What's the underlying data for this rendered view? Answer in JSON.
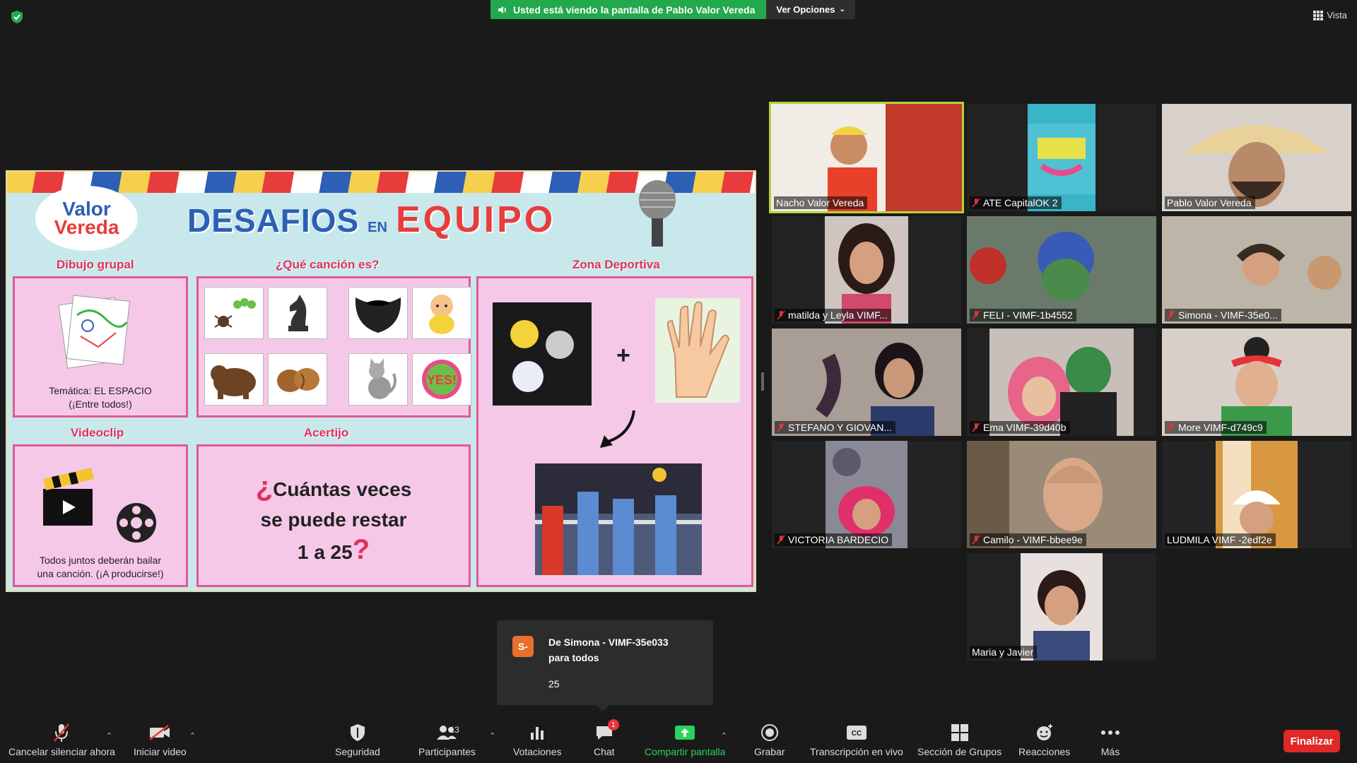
{
  "top_bar": {
    "share_message": "Usted está viendo la pantalla de Pablo Valor Vereda",
    "view_options": "Ver Opciones",
    "view_label": "Vista"
  },
  "slide": {
    "logo_top": "Valor",
    "logo_bottom": "Vereda",
    "title_part1": "DESAFIOS",
    "title_part2": "EN",
    "title_part3": "EQUIPO",
    "sections": {
      "dibujo": {
        "label": "Dibujo grupal",
        "caption_line1": "Temática: EL ESPACIO",
        "caption_line2": "(¡Entre todos!)"
      },
      "cancion": {
        "label": "¿Qué canción es?"
      },
      "deportiva": {
        "label": "Zona Deportiva",
        "plus": "+"
      },
      "videoclip": {
        "label": "Videoclip",
        "caption_line1": "Todos juntos deberán bailar",
        "caption_line2": "una canción. (¡A producirse!)"
      },
      "acertijo": {
        "label": "Acertijo",
        "line1_mark": "¿",
        "line1": "Cuántas veces",
        "line2": "se puede restar",
        "line3": "1 a 25",
        "line3_mark": "?"
      }
    },
    "yes_sticker": "YES!"
  },
  "participants": [
    {
      "name": "Nacho Valor Vereda",
      "muted": false,
      "active": true
    },
    {
      "name": "ATE CapitalOK 2",
      "muted": true,
      "active": false
    },
    {
      "name": "Pablo Valor Vereda",
      "muted": false,
      "active": false
    },
    {
      "name": "matilda y Leyla VIMF...",
      "muted": true,
      "active": false
    },
    {
      "name": "FELI - VIMF-1b4552",
      "muted": true,
      "active": false
    },
    {
      "name": "Simona - VIMF-35e0...",
      "muted": true,
      "active": false
    },
    {
      "name": "STEFANO Y GIOVAN...",
      "muted": true,
      "active": false
    },
    {
      "name": "Ema VIMF-39d40b",
      "muted": true,
      "active": false
    },
    {
      "name": "More VIMF-d749c9",
      "muted": true,
      "active": false
    },
    {
      "name": "VICTORIA BARDECIO",
      "muted": true,
      "active": false
    },
    {
      "name": "Camilo - VIMF-bbee9e",
      "muted": true,
      "active": false
    },
    {
      "name": "LUDMILA VIMF -2edf2e",
      "muted": false,
      "active": false
    },
    {
      "name": "Maria y Javier",
      "muted": false,
      "active": false
    }
  ],
  "chat_toast": {
    "avatar_letter": "S",
    "from_line1": "De Simona - VIMF-35e033",
    "from_line2": "para todos",
    "message": "25"
  },
  "toolbar": {
    "unmute": "Cancelar silenciar ahora",
    "video": "Iniciar video",
    "security": "Seguridad",
    "participants": "Participantes",
    "participants_count": "13",
    "polls": "Votaciones",
    "chat": "Chat",
    "chat_badge": "1",
    "share": "Compartir pantalla",
    "record": "Grabar",
    "captions": "Transcripción en vivo",
    "captions_icon_text": "CC",
    "breakout": "Sección de Grupos",
    "reactions": "Reacciones",
    "more": "Más",
    "end": "Finalizar"
  },
  "colors": {
    "share_green": "#23a94d",
    "active_speaker": "#b5d33a",
    "end_red": "#e02828",
    "share_label_green": "#2bd15e",
    "slide_pink": "#f6c8e8",
    "slide_accent": "#e0305a"
  }
}
